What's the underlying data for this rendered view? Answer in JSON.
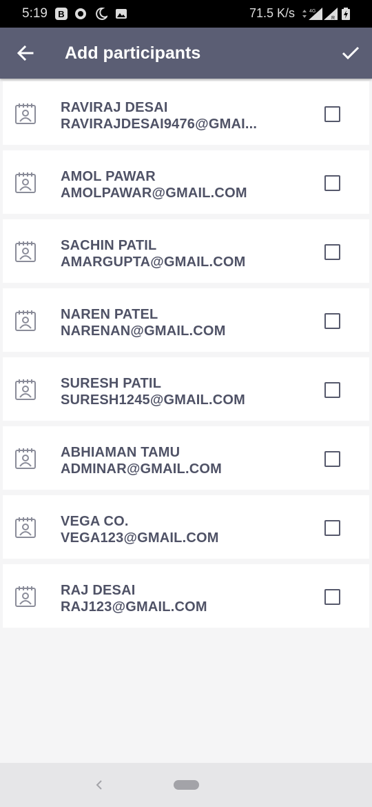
{
  "status_bar": {
    "time": "5:19",
    "speed": "71.5 K/s",
    "icons": [
      "b-icon",
      "circle-icon",
      "moon-icon",
      "image-icon",
      "data-arrows-icon",
      "signal-4g-icon",
      "signal-r-icon",
      "battery-charging-icon"
    ]
  },
  "header": {
    "title": "Add participants",
    "back_icon": "arrow-left-icon",
    "confirm_icon": "check-icon",
    "background": "#5b5e74"
  },
  "participants": [
    {
      "name": "RAVIRAJ DESAI",
      "email": "RAVIRAJDESAI9476@GMAI...",
      "checked": false
    },
    {
      "name": "AMOL PAWAR",
      "email": "AMOLPAWAR@GMAIL.COM",
      "checked": false
    },
    {
      "name": "SACHIN PATIL",
      "email": "AMARGUPTA@GMAIL.COM",
      "checked": false
    },
    {
      "name": "NAREN PATEL",
      "email": "NARENAN@GMAIL.COM",
      "checked": false
    },
    {
      "name": "SURESH PATIL",
      "email": "SURESH1245@GMAIL.COM",
      "checked": false
    },
    {
      "name": "ABHIAMAN TAMU",
      "email": "ADMINAR@GMAIL.COM",
      "checked": false
    },
    {
      "name": "VEGA CO.",
      "email": "VEGA123@GMAIL.COM",
      "checked": false
    },
    {
      "name": "RAJ DESAI",
      "email": "RAJ123@GMAIL.COM",
      "checked": false
    }
  ],
  "text_color": "#4f5266",
  "nav_bar": {
    "back_icon": "chevron-left-icon",
    "home_icon": "home-pill-icon"
  }
}
